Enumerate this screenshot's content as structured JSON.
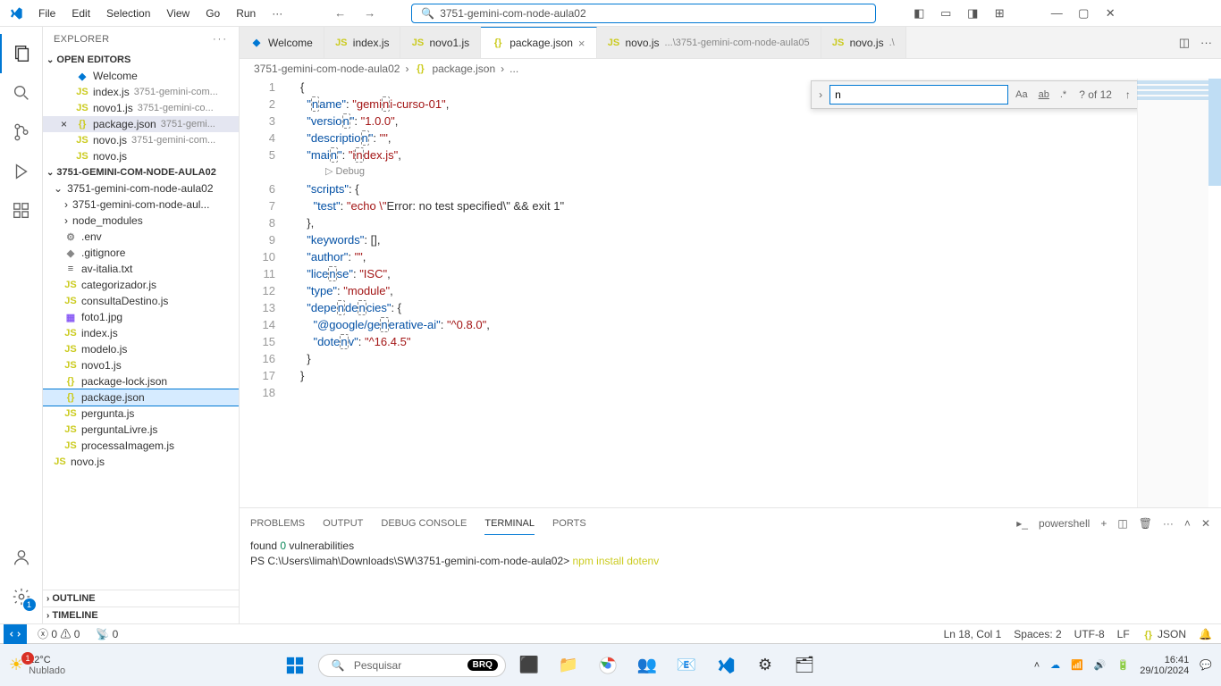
{
  "menu": {
    "file": "File",
    "edit": "Edit",
    "selection": "Selection",
    "view": "View",
    "go": "Go",
    "run": "Run",
    "more": "···"
  },
  "search_center": "3751-gemini-com-node-aula02",
  "explorer": {
    "title": "EXPLORER",
    "dots": "···"
  },
  "openEditors": {
    "label": "OPEN EDITORS"
  },
  "editors": [
    {
      "icon": "vs",
      "name": "Welcome",
      "x": ""
    },
    {
      "icon": "js",
      "name": "index.js",
      "meta": "3751-gemini-com..."
    },
    {
      "icon": "js",
      "name": "novo1.js",
      "meta": "3751-gemini-co..."
    },
    {
      "icon": "json",
      "name": "package.json",
      "meta": "3751-gemi...",
      "active": true,
      "x": "×"
    },
    {
      "icon": "js",
      "name": "novo.js",
      "meta": "3751-gemini-com..."
    },
    {
      "icon": "js",
      "name": "novo.js"
    }
  ],
  "folderHeader": "3751-GEMINI-COM-NODE-AULA02",
  "tree": [
    {
      "kind": "folder",
      "name": "3751-gemini-com-node-aula02",
      "depth": 0,
      "open": true
    },
    {
      "kind": "folder",
      "name": "3751-gemini-com-node-aul...",
      "depth": 1,
      "open": false
    },
    {
      "kind": "folder",
      "name": "node_modules",
      "depth": 1,
      "open": false
    },
    {
      "kind": "file",
      "icon": "env",
      "name": ".env",
      "depth": 1
    },
    {
      "kind": "file",
      "icon": "git",
      "name": ".gitignore",
      "depth": 1
    },
    {
      "kind": "file",
      "icon": "txt",
      "name": "av-italia.txt",
      "depth": 1
    },
    {
      "kind": "file",
      "icon": "js",
      "name": "categorizador.js",
      "depth": 1
    },
    {
      "kind": "file",
      "icon": "js",
      "name": "consultaDestino.js",
      "depth": 1
    },
    {
      "kind": "file",
      "icon": "img",
      "name": "foto1.jpg",
      "depth": 1
    },
    {
      "kind": "file",
      "icon": "js",
      "name": "index.js",
      "depth": 1
    },
    {
      "kind": "file",
      "icon": "js",
      "name": "modelo.js",
      "depth": 1
    },
    {
      "kind": "file",
      "icon": "js",
      "name": "novo1.js",
      "depth": 1
    },
    {
      "kind": "file",
      "icon": "json",
      "name": "package-lock.json",
      "depth": 1
    },
    {
      "kind": "file",
      "icon": "json",
      "name": "package.json",
      "depth": 1,
      "active": true
    },
    {
      "kind": "file",
      "icon": "js",
      "name": "pergunta.js",
      "depth": 1
    },
    {
      "kind": "file",
      "icon": "js",
      "name": "perguntaLivre.js",
      "depth": 1
    },
    {
      "kind": "file",
      "icon": "js",
      "name": "processaImagem.js",
      "depth": 1
    },
    {
      "kind": "file",
      "icon": "js",
      "name": "novo.js",
      "depth": 0
    }
  ],
  "outline": "OUTLINE",
  "timeline": "TIMELINE",
  "tabs": [
    {
      "icon": "vs",
      "label": "Welcome"
    },
    {
      "icon": "js",
      "label": "index.js"
    },
    {
      "icon": "js",
      "label": "novo1.js"
    },
    {
      "icon": "json",
      "label": "package.json",
      "active": true,
      "close": "×"
    },
    {
      "icon": "js",
      "label": "novo.js",
      "meta": "...\\3751-gemini-com-node-aula05"
    },
    {
      "icon": "js",
      "label": "novo.js",
      "meta": ".\\"
    }
  ],
  "crumbs": {
    "a": "3751-gemini-com-node-aula02",
    "b": "package.json",
    "c": "..."
  },
  "find": {
    "value": "n",
    "count": "? of 12"
  },
  "code": {
    "lines": [
      "{",
      "  \"name\": \"gemini-curso-01\",",
      "  \"version\": \"1.0.0\",",
      "  \"description\": \"\",",
      "  \"main\": \"index.js\",",
      "  \"scripts\": {",
      "    \"test\": \"echo \\\"Error: no test specified\\\" && exit 1\"",
      "  },",
      "  \"keywords\": [],",
      "  \"author\": \"\",",
      "  \"license\": \"ISC\",",
      "  \"type\": \"module\",",
      "  \"dependencies\": {",
      "    \"@google/generative-ai\": \"^0.8.0\",",
      "    \"dotenv\": \"^16.4.5\"",
      "  }",
      "}",
      ""
    ],
    "debugLabel": "Debug"
  },
  "panel": {
    "tabs": {
      "problems": "PROBLEMS",
      "output": "OUTPUT",
      "debug": "DEBUG CONSOLE",
      "terminal": "TERMINAL",
      "ports": "PORTS"
    },
    "shell": "powershell",
    "lines": {
      "l1a": "found ",
      "l1z": "0",
      "l1b": " vulnerabilities",
      "prompt": "PS C:\\Users\\limah\\Downloads\\SW\\3751-gemini-com-node-aula02> ",
      "cmd": "npm install dotenv"
    }
  },
  "status": {
    "err": "0",
    "warn": "0",
    "port": "0",
    "pos": "Ln 18, Col 1",
    "spaces": "Spaces: 2",
    "enc": "UTF-8",
    "eol": "LF",
    "lang": "JSON"
  },
  "taskbar": {
    "temp": "22°C",
    "cond": "Nublado",
    "search": "Pesquisar",
    "brq": "BRQ",
    "time": "16:41",
    "date": "29/10/2024"
  }
}
